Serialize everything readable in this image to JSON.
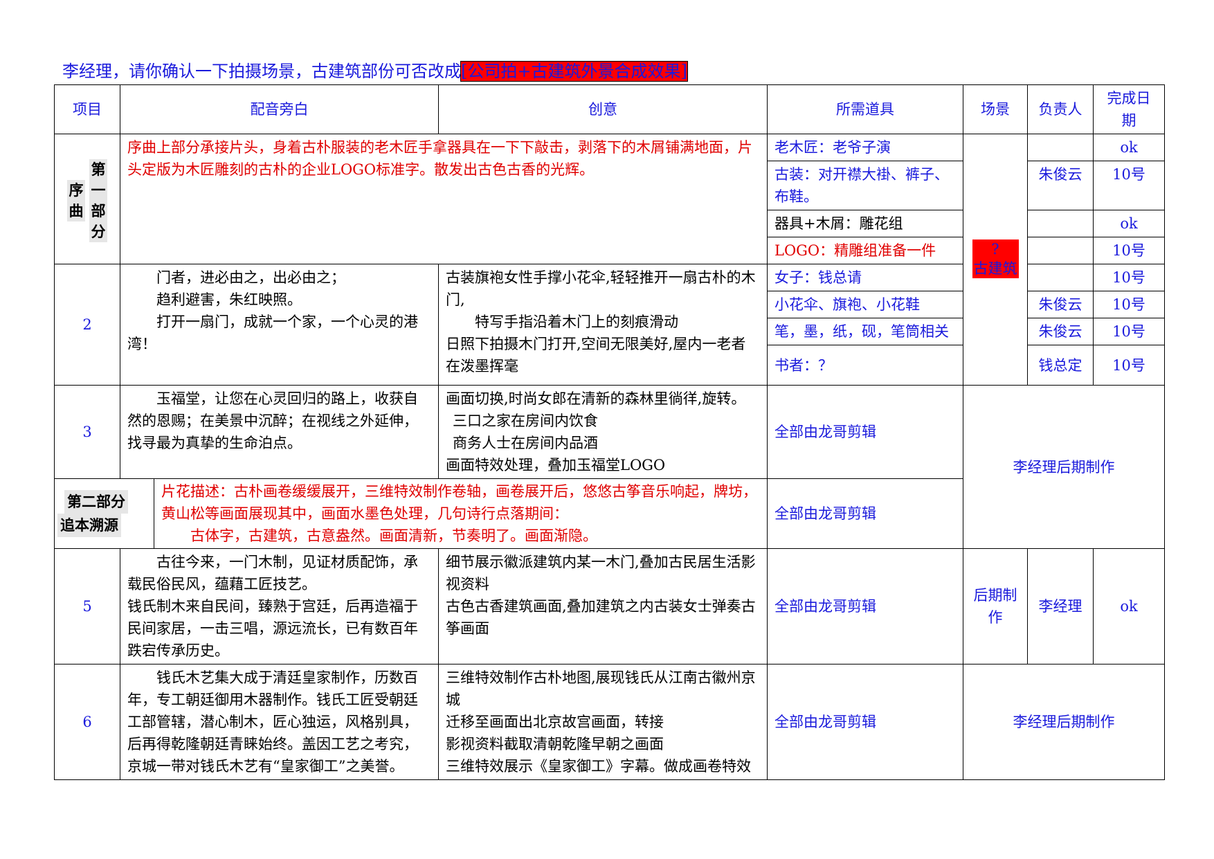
{
  "title": {
    "main": "李经理，请你确认一下拍摄场景，古建筑部份可否改成",
    "highlight": "[公司拍+古建筑外景合成效果]"
  },
  "headers": {
    "item": "项目",
    "narration": "配音旁白",
    "idea": "创意",
    "props": "所需道具",
    "scene": "场景",
    "owner": "负责人",
    "due": "完成日期"
  },
  "prelude": {
    "label_a": "序曲",
    "label_b": "第一部分",
    "description": "序曲上部分承接片头，身着古朴服装的老木匠手拿器具在一下下敲击，剥落下的木屑铺满地面，片头定版为木匠雕刻的古朴的企业LOGO标准字。散发出古色古香的光辉。",
    "props": [
      {
        "text": "老木匠：老爷子演",
        "owner": "",
        "due": "ok"
      },
      {
        "text": "古装：对开襟大褂、裤子、布鞋。",
        "owner": "朱俊云",
        "due": "10号"
      },
      {
        "text": "器具+木屑：雕花组",
        "owner": "",
        "due": "ok"
      },
      {
        "text": "LOGO：精雕组准备一件",
        "owner": "",
        "due": "10号"
      }
    ]
  },
  "scene_mark": {
    "q": "?",
    "label": "古建筑"
  },
  "row2": {
    "num": "2",
    "narration": [
      "门者，进必由之，出必由之；",
      "趋利避害，朱红映照。",
      "打开一扇门，成就一个家，一个心灵的港湾！"
    ],
    "idea": [
      "古装旗袍女性手撑小花伞,轻轻推开一扇古朴的木门,",
      "特写手指沿着木门上的刻痕滑动",
      "日照下拍摄木门打开,空间无限美好,屋内一老者在泼墨挥毫"
    ],
    "props": [
      {
        "text": "女子：钱总请",
        "owner": "",
        "due": "10号"
      },
      {
        "text": "小花伞、旗袍、小花鞋",
        "owner": "朱俊云",
        "due": "10号"
      },
      {
        "text": "笔，墨，纸，砚，笔筒相关",
        "owner": "朱俊云",
        "due": "10号"
      },
      {
        "text": "书者：？",
        "owner": "钱总定",
        "due": "10号"
      }
    ]
  },
  "row3": {
    "num": "3",
    "narration": "玉福堂，让您在心灵回归的路上，收获自然的恩赐；在美景中沉醉；在视线之外延伸，找寻最为真挚的生命泊点。",
    "idea": [
      "画面切换,时尚女郎在清新的森林里徜徉,旋转。",
      "三口之家在房间内饮食",
      "商务人士在房间内品酒",
      "画面特效处理，叠加玉福堂LOGO"
    ],
    "props": "全部由龙哥剪辑"
  },
  "merged_post": "李经理后期制作",
  "part2": {
    "label_a": "第二部分",
    "label_b": "追本溯源",
    "description": "片花描述：古朴画卷缓缓展开，三维特效制作卷轴，画卷展开后，悠悠古筝音乐响起，牌坊，黄山松等画面展现其中，画面水墨色处理，几句诗行点落期间：",
    "description2": "古体字，古建筑，古意盎然。画面清新，节奏明了。画面渐隐。",
    "props": "全部由龙哥剪辑"
  },
  "row5": {
    "num": "5",
    "narration_a": "古往今来，一门木制，见证材质配饰，承载民俗民风，蕴藉工匠技艺。",
    "narration_b": "钱氏制木来自民间，臻熟于宫廷，后再造福于民间家居，一击三唱，源远流长，已有数百年跌宕传承历史。",
    "idea": [
      "细节展示徽派建筑内某一木门,叠加古民居生活影视资料",
      "古色古香建筑画面,叠加建筑之内古装女士弹奏古筝画面"
    ],
    "props": "全部由龙哥剪辑",
    "scene": "后期制作",
    "owner": "李经理",
    "due": "ok"
  },
  "row6": {
    "num": "6",
    "narration": "钱氏木艺集大成于清廷皇家制作，历数百年，专工朝廷御用木器制作。钱氏工匠受朝廷工部管辖，潜心制木，匠心独运，风格别具，后再得乾隆朝廷青睐始终。盖因工艺之考究，京城一带对钱氏木艺有“皇家御工”之美誉。",
    "idea": [
      "三维特效制作古朴地图,展现钱氏从江南古徽州京城",
      "迁移至画面出北京故宫画面，转接",
      "影视资料截取清朝乾隆早朝之画面",
      "三维特效展示《皇家御工》字幕。做成画卷特效"
    ],
    "props": "全部由龙哥剪辑",
    "post": "李经理后期制作"
  }
}
